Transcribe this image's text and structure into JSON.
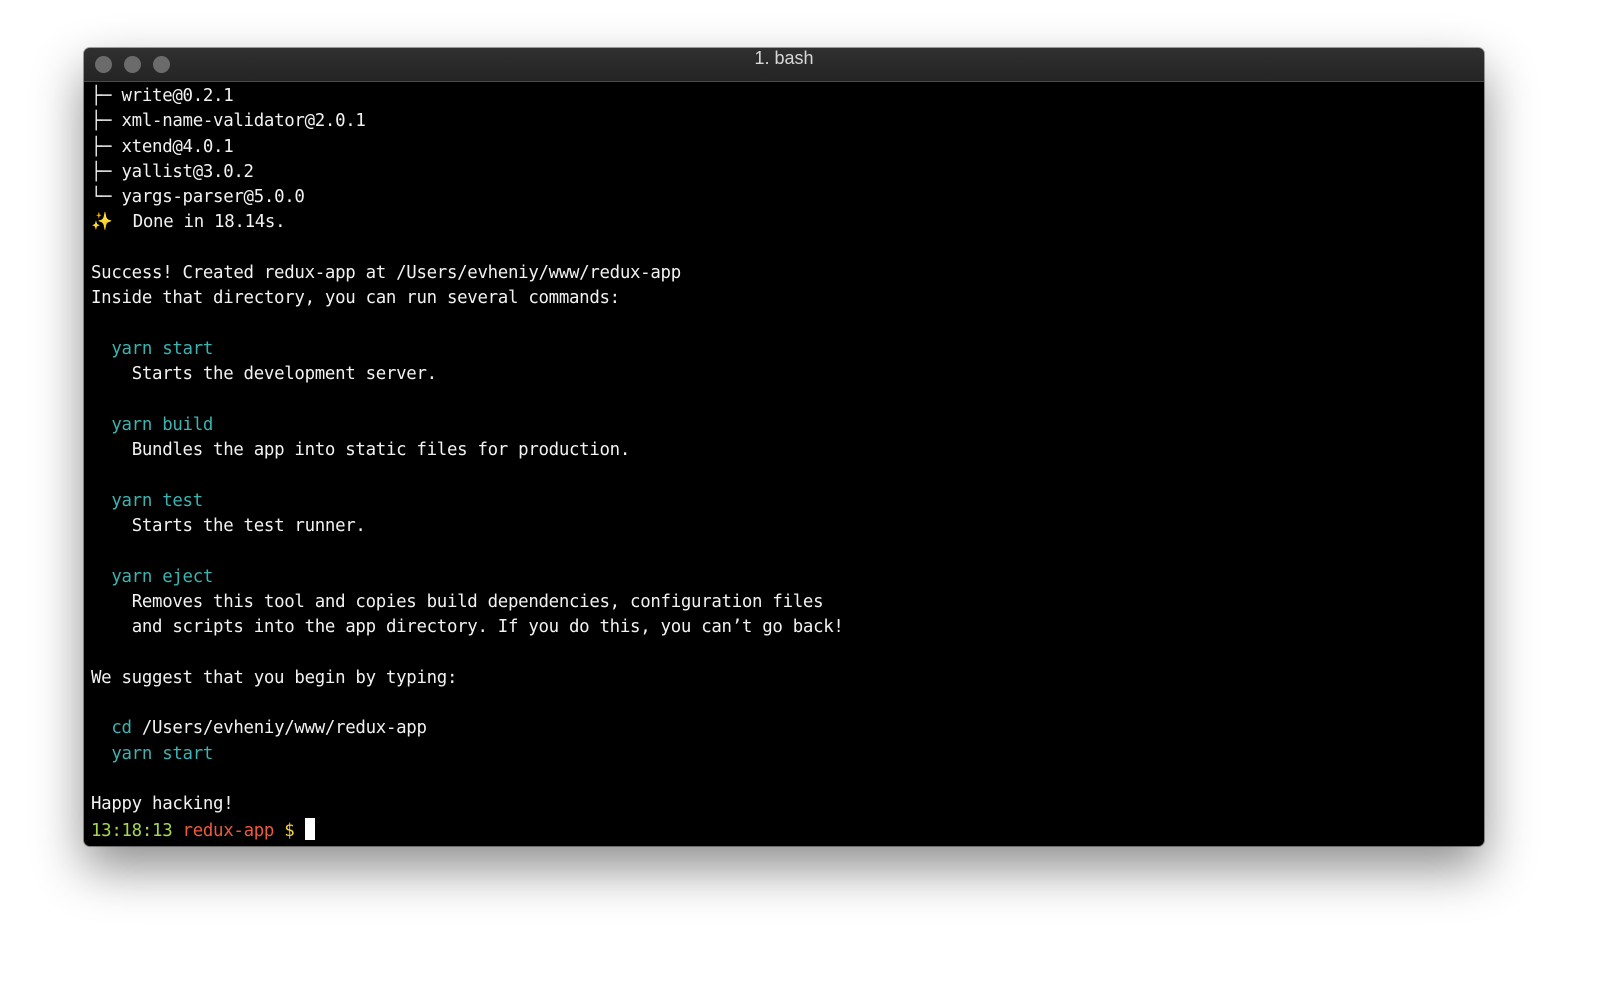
{
  "window": {
    "title": "1. bash"
  },
  "terminal": {
    "tree": [
      {
        "branch": "├─ ",
        "text": "write@0.2.1"
      },
      {
        "branch": "├─ ",
        "text": "xml-name-validator@2.0.1"
      },
      {
        "branch": "├─ ",
        "text": "xtend@4.0.1"
      },
      {
        "branch": "├─ ",
        "text": "yallist@3.0.2"
      },
      {
        "branch": "└─ ",
        "text": "yargs-parser@5.0.0"
      }
    ],
    "done_icon": "✨",
    "done": "  Done in 18.14s.",
    "success": "Success! Created redux-app at /Users/evheniy/www/redux-app",
    "inside": "Inside that directory, you can run several commands:",
    "commands": [
      {
        "cmd": "yarn start",
        "desc": [
          "Starts the development server."
        ]
      },
      {
        "cmd": "yarn build",
        "desc": [
          "Bundles the app into static files for production."
        ]
      },
      {
        "cmd": "yarn test",
        "desc": [
          "Starts the test runner."
        ]
      },
      {
        "cmd": "yarn eject",
        "desc": [
          "Removes this tool and copies build dependencies, configuration files",
          "and scripts into the app directory. If you do this, you can’t go back!"
        ]
      }
    ],
    "suggest": "We suggest that you begin by typing:",
    "cd_cmd": "cd",
    "cd_path": " /Users/evheniy/www/redux-app",
    "start_cmd": "yarn start",
    "happy": "Happy hacking!",
    "prompt": {
      "time": "13:18:13",
      "dir": "redux-app",
      "symbol": "$"
    }
  },
  "colors": {
    "cyan": "#3bb3b0",
    "green": "#a5d74d",
    "red": "#f05a3c",
    "yellow": "#f3d23a"
  }
}
